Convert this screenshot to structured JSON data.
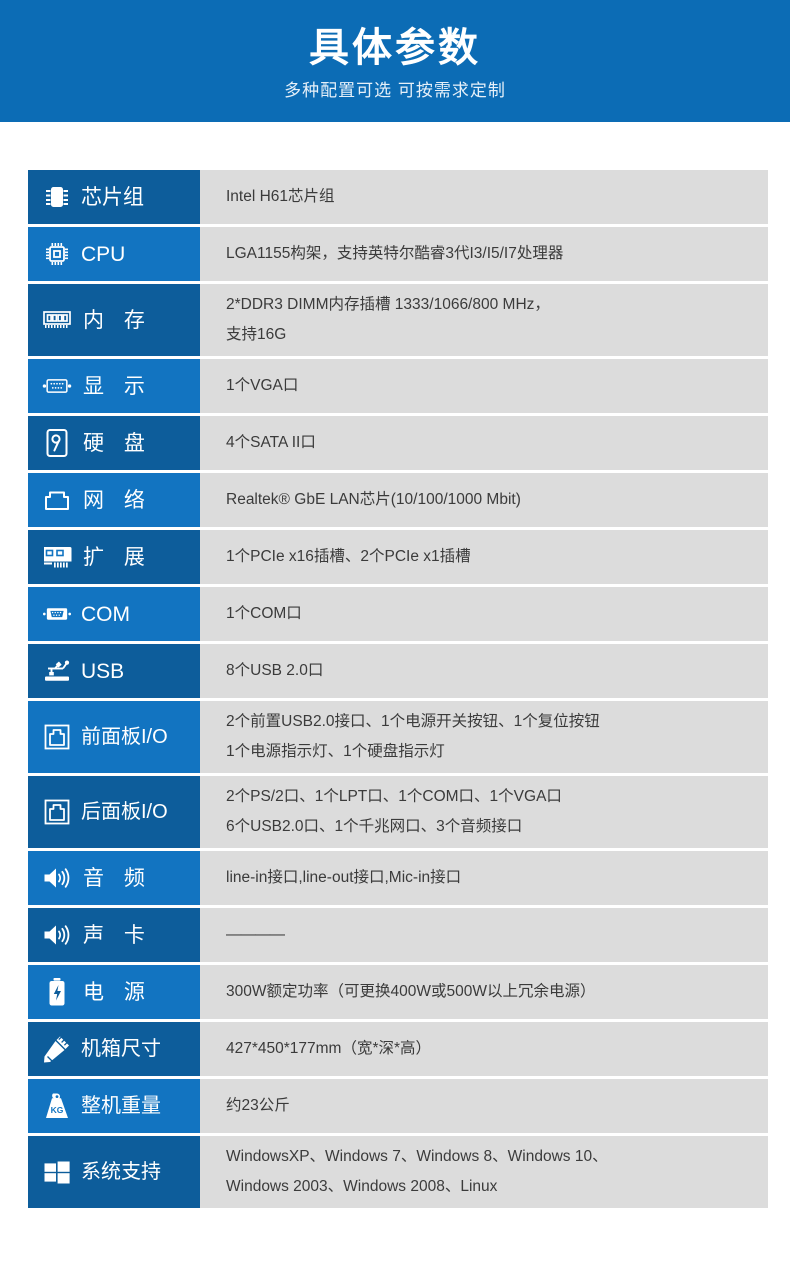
{
  "banner": {
    "title": "具体参数",
    "subtitle": "多种配置可选 可按需求定制",
    "bg_color": "#0c6cb5"
  },
  "colors": {
    "label_dark": "#0d5d9b",
    "label_light": "#1274c1",
    "value_bg": "#dcdcdc",
    "value_text": "#3b3b3b",
    "label_text": "#ffffff"
  },
  "spec_rows": [
    {
      "icon": "chipset-icon",
      "label": "芯片组",
      "lines": [
        "Intel H61芯片组"
      ]
    },
    {
      "icon": "cpu-icon",
      "label": "CPU",
      "lines": [
        "LGA1155构架，支持英特尔酷睿3代I3/I5/I7处理器"
      ]
    },
    {
      "icon": "memory-icon",
      "label": "内 存",
      "lines": [
        "2*DDR3 DIMM内存插槽 1333/1066/800 MHz，",
        "支持16G"
      ]
    },
    {
      "icon": "vga-display-icon",
      "label": "显 示",
      "lines": [
        "1个VGA口"
      ]
    },
    {
      "icon": "harddisk-icon",
      "label": "硬 盘",
      "lines": [
        "4个SATA II口"
      ]
    },
    {
      "icon": "network-icon",
      "label": "网 络",
      "lines": [
        "Realtek® GbE LAN芯片(10/100/1000 Mbit)"
      ]
    },
    {
      "icon": "expansion-card-icon",
      "label": "扩 展",
      "lines": [
        "1个PCIe x16插槽、2个PCIe x1插槽"
      ]
    },
    {
      "icon": "serial-port-icon",
      "label": "COM",
      "lines": [
        "1个COM口"
      ]
    },
    {
      "icon": "usb-icon",
      "label": "USB",
      "lines": [
        "8个USB 2.0口"
      ]
    },
    {
      "icon": "front-panel-io-icon",
      "label": "前面板I/O",
      "lines": [
        "2个前置USB2.0接口、1个电源开关按钮、1个复位按钮",
        "1个电源指示灯、1个硬盘指示灯"
      ]
    },
    {
      "icon": "rear-panel-io-icon",
      "label": "后面板I/O",
      "lines": [
        "2个PS/2口、1个LPT口、1个COM口、1个VGA口",
        "6个USB2.0口、1个千兆网口、3个音频接口"
      ]
    },
    {
      "icon": "audio-icon",
      "label": "音 频",
      "lines": [
        "line-in接口,line-out接口,Mic-in接口"
      ]
    },
    {
      "icon": "soundcard-icon",
      "label": "声 卡",
      "lines": [
        "————"
      ]
    },
    {
      "icon": "power-icon",
      "label": "电 源",
      "lines": [
        "300W额定功率（可更换400W或500W以上冗余电源）"
      ]
    },
    {
      "icon": "dimension-icon",
      "label": "机箱尺寸",
      "lines": [
        "427*450*177mm（宽*深*高）"
      ]
    },
    {
      "icon": "weight-icon",
      "label": "整机重量",
      "lines": [
        "约23公斤"
      ]
    },
    {
      "icon": "windows-icon",
      "label": "系统支持",
      "lines": [
        "WindowsXP、Windows 7、Windows 8、Windows 10、",
        "Windows 2003、Windows 2008、Linux"
      ]
    }
  ]
}
